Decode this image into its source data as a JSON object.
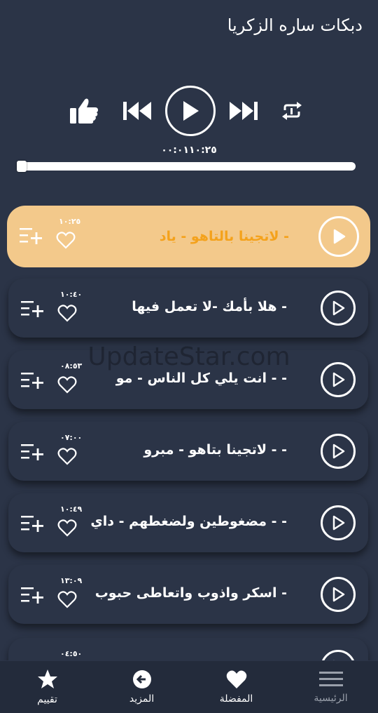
{
  "header": {
    "title": "دبكات ساره الزكريا"
  },
  "player": {
    "time": "٠٠:٠١١٠:٢٥",
    "progress": 0.0
  },
  "icons": {
    "like": "thumbs-up-icon",
    "previous": "skip-previous-icon",
    "play": "play-icon",
    "next": "skip-next-icon",
    "repeat": "repeat-icon",
    "favorite": "heart-icon",
    "add_to_queue": "playlist-add-icon"
  },
  "colors": {
    "background": "#2b3447",
    "active_row": "#f3c98b",
    "active_text": "#f4a21c",
    "nav_bg": "#232b3b"
  },
  "tracks": [
    {
      "title": "-  لاتجينا بالتاهو  -  ياد",
      "duration": "١٠:٢٥",
      "active": true
    },
    {
      "title": "-  هلا بأمك -لا تعمل فيها",
      "duration": "١٠:٤٠",
      "active": false
    },
    {
      "title": "- -  انت يلي كل الناس - مو",
      "duration": "٠٨:٥٣",
      "active": false
    },
    {
      "title": "- -  لاتجينا بتاهو  -  مبرو",
      "duration": "٠٧:٠٠",
      "active": false
    },
    {
      "title": "- -  مضغوطين ولضغطهم - داي",
      "duration": "١٠:٤٩",
      "active": false
    },
    {
      "title": "-  اسكر واذوب واتعاطى حبوب",
      "duration": "١٣:٠٩",
      "active": false
    },
    {
      "title": "",
      "duration": "٠٤:٥٠",
      "active": false
    }
  ],
  "watermark": "UpdateStar.com",
  "nav": [
    {
      "label": "تقييم",
      "icon": "star-icon"
    },
    {
      "label": "المزيد",
      "icon": "arrow-left-circle-icon"
    },
    {
      "label": "المفضلة",
      "icon": "heart-icon"
    },
    {
      "label": "الرئيسية",
      "icon": "menu-icon"
    }
  ]
}
